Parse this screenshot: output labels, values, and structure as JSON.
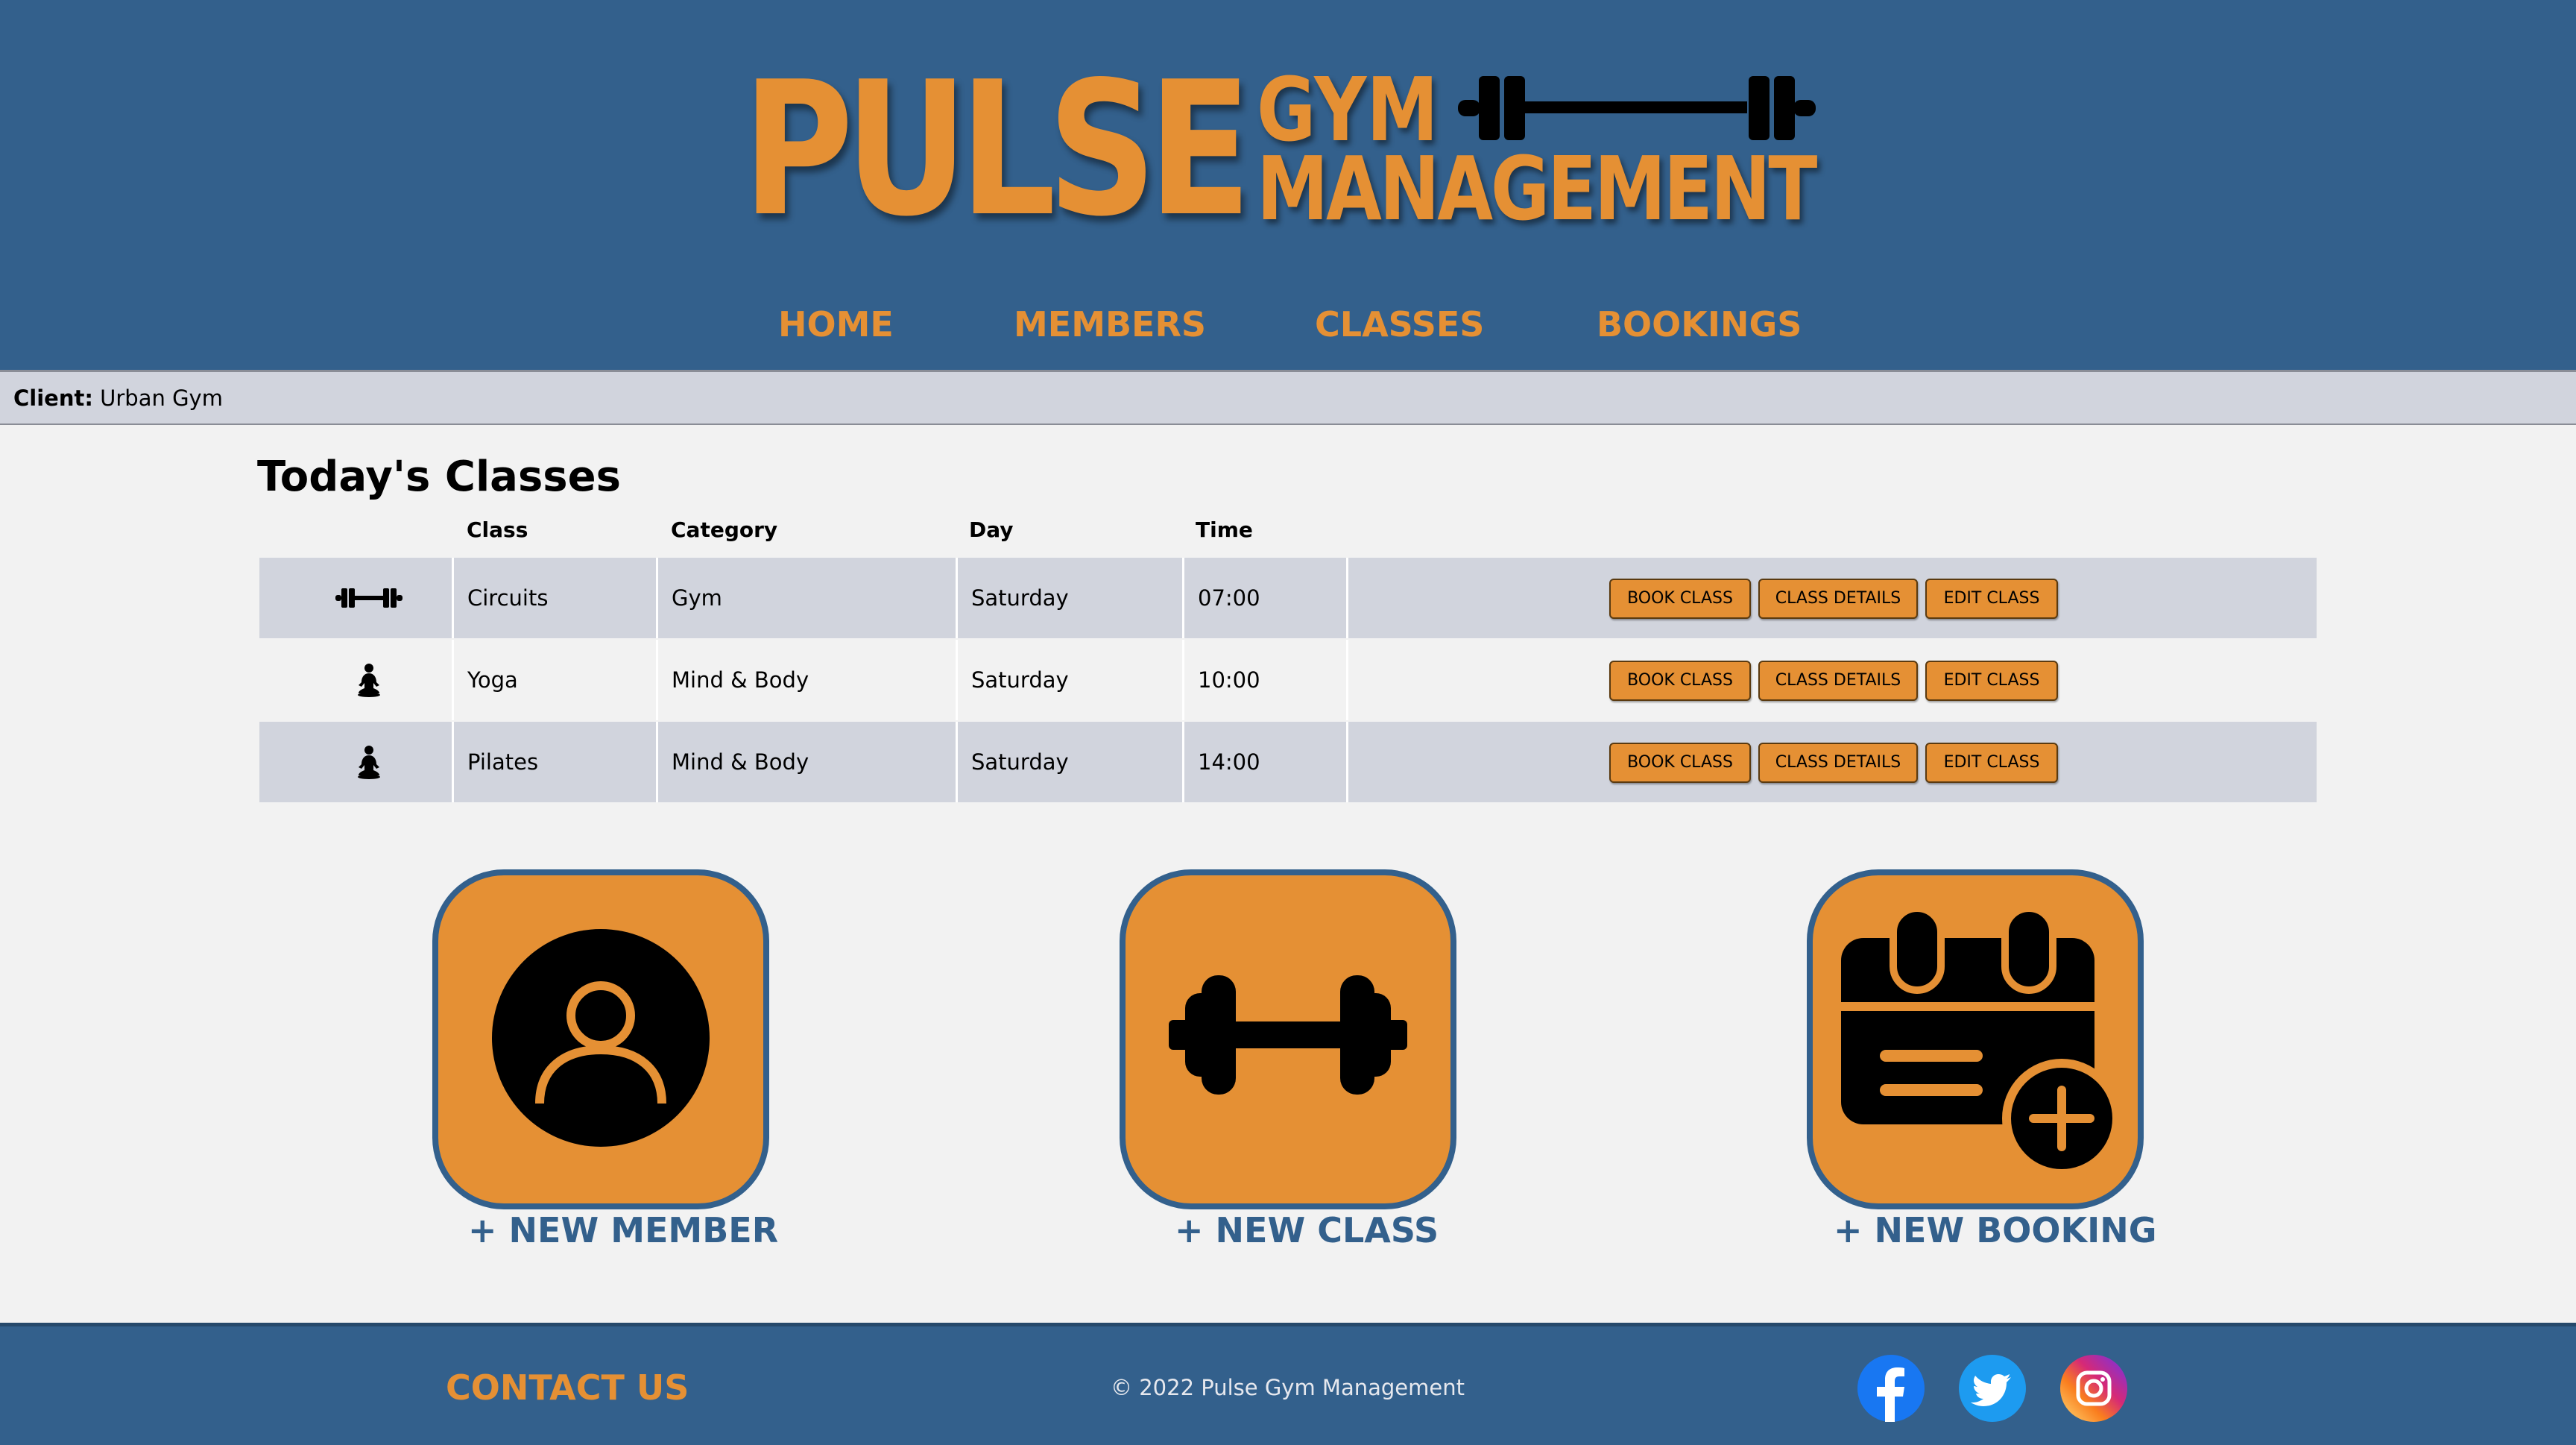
{
  "brand": {
    "name_big": "PULSE",
    "name_small_1": "GYM",
    "name_small_2": "MANAGEMENT"
  },
  "nav": {
    "items": [
      {
        "label": "HOME"
      },
      {
        "label": "MEMBERS"
      },
      {
        "label": "CLASSES"
      },
      {
        "label": "BOOKINGS"
      }
    ]
  },
  "client": {
    "label": "Client:",
    "value": "Urban Gym"
  },
  "classes_section": {
    "title": "Today's Classes",
    "headers": {
      "class": "Class",
      "category": "Category",
      "day": "Day",
      "time": "Time"
    },
    "rows": [
      {
        "icon": "barbell-icon",
        "class": "Circuits",
        "category": "Gym",
        "day": "Saturday",
        "time": "07:00"
      },
      {
        "icon": "meditation-icon",
        "class": "Yoga",
        "category": "Mind & Body",
        "day": "Saturday",
        "time": "10:00"
      },
      {
        "icon": "meditation-icon",
        "class": "Pilates",
        "category": "Mind & Body",
        "day": "Saturday",
        "time": "14:00"
      }
    ],
    "actions": {
      "book": "BOOK CLASS",
      "details": "CLASS DETAILS",
      "edit": "EDIT CLASS"
    }
  },
  "quick_actions": {
    "new_member": "+ NEW MEMBER",
    "new_class": "+ NEW CLASS",
    "new_booking": "+ NEW BOOKING"
  },
  "footer": {
    "contact": "CONTACT US",
    "copyright": "© 2022 Pulse Gym Management",
    "social": [
      "facebook-icon",
      "twitter-icon",
      "instagram-icon"
    ]
  },
  "colors": {
    "primary_blue": "#33608c",
    "accent_orange": "#e59034",
    "row_shade": "#d1d4dd",
    "background": "#f2f2f2"
  }
}
